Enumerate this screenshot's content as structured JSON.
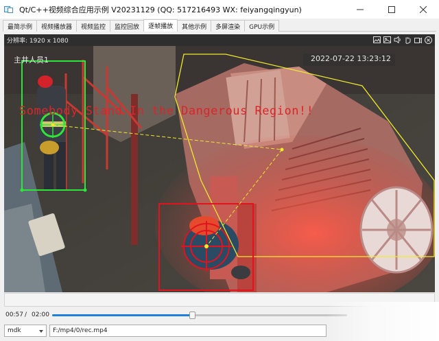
{
  "window": {
    "title": "Qt/C++视频综合应用示例 V20231129 (QQ: 517216493 WX: feiyangqingyun)",
    "controls": [
      "minimize-icon",
      "maximize-icon",
      "close-icon"
    ]
  },
  "tabs": [
    {
      "label": "最简示例",
      "active": false
    },
    {
      "label": "视频播放器",
      "active": false
    },
    {
      "label": "视频监控",
      "active": false
    },
    {
      "label": "监控回放",
      "active": false
    },
    {
      "label": "逐帧播放",
      "active": true
    },
    {
      "label": "其他示例",
      "active": false
    },
    {
      "label": "多屏渲染",
      "active": false
    },
    {
      "label": "GPU示例",
      "active": false
    }
  ],
  "video": {
    "resolution_label": "分辨率: 1920 x 1080",
    "toolbar_icons": [
      "image-icon",
      "snapshot-icon",
      "volume-icon",
      "hand-icon",
      "record-icon",
      "close-icon"
    ],
    "osd": {
      "name": "主井人员1",
      "time": "2022-07-22 13:23:12",
      "warning": "Somebody Stand In the Dangerous Region!!"
    },
    "colors": {
      "person_box": "#2ee63a",
      "danger_box": "#e0141e",
      "region": "#f0ea2c"
    }
  },
  "playback": {
    "current": "00:57",
    "separator": "/",
    "total": "02:00",
    "progress": 0.475
  },
  "source": {
    "decoder": "mdk",
    "path": "F:/mp4/0/rec.mp4"
  }
}
